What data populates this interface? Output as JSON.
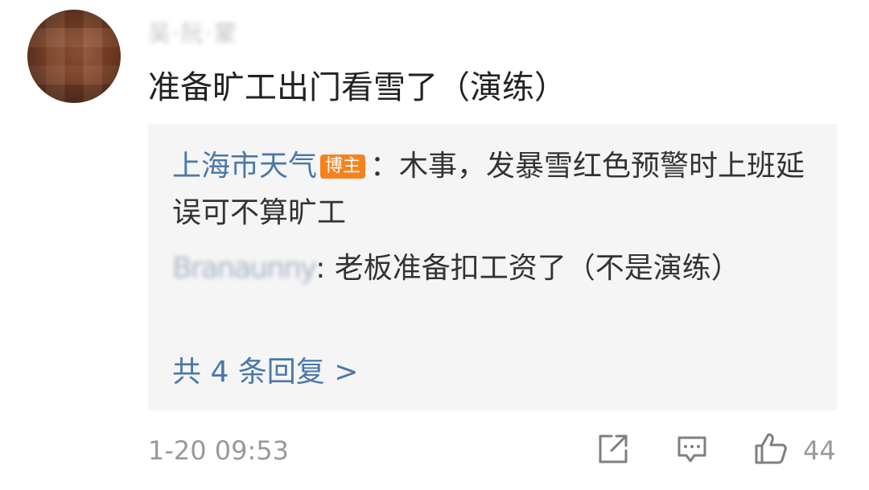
{
  "comment": {
    "username": "吴·阮·蒙",
    "text": "准备旷工出门看雪了（演练）"
  },
  "replies": [
    {
      "name": "上海市天气",
      "badge": "博主",
      "text": "：木事，发暴雪红色预警时上班延误可不算旷工"
    },
    {
      "name": "Branaunny",
      "text": ": 老板准备扣工资了（不是演练）"
    }
  ],
  "more_replies": "共 4 条回复 >",
  "footer": {
    "timestamp": "1-20 09:53",
    "like_count": "44",
    "icons": [
      "share-icon",
      "comment-icon",
      "like-icon"
    ]
  },
  "colors": {
    "link_blue": "#4a78a8",
    "badge_orange": "#f6821f",
    "reply_bg": "#f5f5f5",
    "meta_gray": "#999999"
  }
}
